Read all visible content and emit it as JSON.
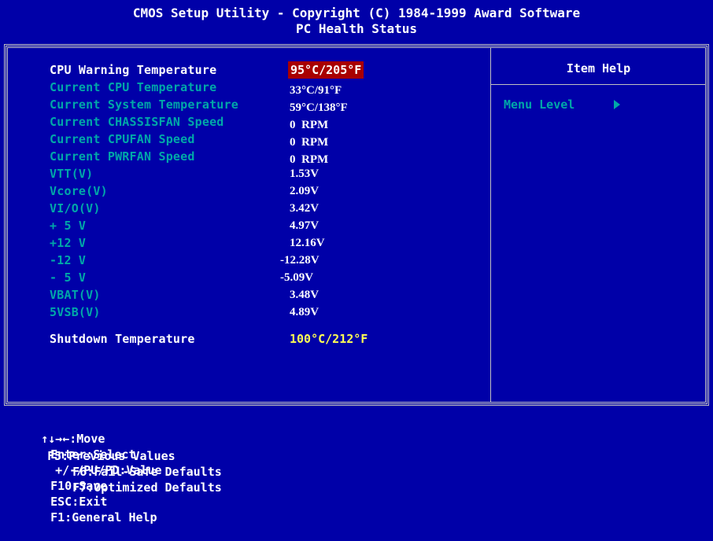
{
  "header": {
    "title": "CMOS Setup Utility - Copyright (C) 1984-1999 Award Software",
    "subtitle": "PC Health Status"
  },
  "items": [
    {
      "label": "CPU Warning Temperature",
      "value": "95°C/205°F"
    },
    {
      "label": "Current CPU Temperature",
      "value": "33°C/91°F"
    },
    {
      "label": "Current System Temperature",
      "value": "59°C/138°F"
    },
    {
      "label": "Current CHASSISFAN Speed",
      "value": "0  RPM"
    },
    {
      "label": "Current CPUFAN Speed",
      "value": "0  RPM"
    },
    {
      "label": "Current PWRFAN Speed",
      "value": "0  RPM"
    },
    {
      "label": "VTT(V)",
      "value": "1.53V"
    },
    {
      "label": "Vcore(V)",
      "value": "2.09V"
    },
    {
      "label": "VI/O(V)",
      "value": "3.42V"
    },
    {
      "label": "+ 5 V",
      "value": "4.97V"
    },
    {
      "label": "+12 V",
      "value": "12.16V"
    },
    {
      "label": "-12 V",
      "value": "-12.28V"
    },
    {
      "label": "- 5 V",
      "value": "-5.09V"
    },
    {
      "label": "VBAT(V)",
      "value": "3.48V"
    },
    {
      "label": "5VSB(V)",
      "value": "4.89V"
    },
    {
      "label": "Shutdown Temperature",
      "value": "100°C/212°F"
    }
  ],
  "help": {
    "title": "Item Help",
    "menu_level": "Menu Level"
  },
  "footer": {
    "move": "↑↓→←:Move",
    "enter": "Enter:Select",
    "value": "+/-/PU/PD:Value",
    "save": "F10:Save",
    "exit": "ESC:Exit",
    "help": "F1:General Help",
    "prev": "F5:Previous Values",
    "failsafe": "F6:Fail-Safe Defaults",
    "optimized": "F7:Optimized Defaults"
  },
  "colors": {
    "background": "#0000a8",
    "label": "#00a8a8",
    "highlight": "#a80000",
    "shutdown_value": "#ffff54"
  }
}
